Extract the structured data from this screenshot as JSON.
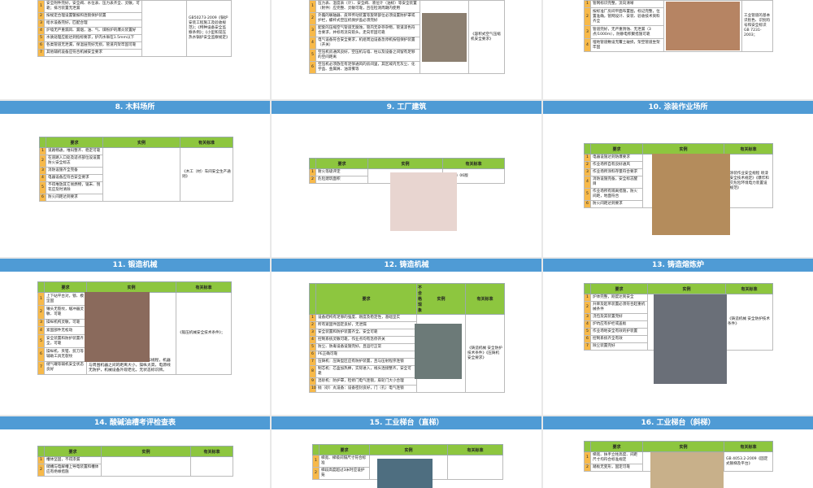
{
  "top_row": {
    "left": {
      "rows": [
        "安全附件完好，安全阀、水位表、压力表齐全、灵敏，可靠；排污装置无泄漏",
        "按规定合理设置警报和连锁保护装置",
        "给水设备完好，匹配合理",
        "炉墙无严重漏风、漏烟，油、气、煤粉炉的爆炎装置好",
        "水质处理应能达到指标要求，炉内水垢在1.5mm以下",
        "各类管道无泄漏，保温层完好无损，管道内架牢固可靠",
        "其他辅机设备应符合机械安全要求"
      ],
      "standard": "GB50273-2009《锅炉安装工程施工及验收规范》；《特种设备安全监察条例》；《小型和常压热水锅炉安全监察规定》"
    },
    "mid": {
      "rows": [
        "压力表、温度表（计）、安全阀、液位计（油标）等安全装置（附件）应完整、灵敏可靠，且在检测周期内使用",
        "外露的联轴器、皮带传动装置等旋转部位必须设置防护罩或护栏，螺杆式空压机保护盖必须完好",
        "配套的压缩空气管道无腐蚀，管内无杂存杂物，管道漆色符合要求，并标有流向箭头，走向牢固可靠",
        "电气设备符合安全要求，机组周边设备急停机按钮保护装置（开关）",
        "空压机房通风良好，空压机与墙、柱以及设备之间留有足够的空间距离",
        "空压机必须放在有足够通风的房间里，其区域内无灰尘、化学品、金属屑、油漆雾等"
      ],
      "standard": "《容积式空气压缩机安全要求》"
    },
    "right": {
      "rows": [
        "管网标识完整，流向清晰",
        "按标准厂房间平面布置图，标记完整，位置准确，管网设计、安装、验收技术资料齐全",
        "管道完好，无严重锈蚀、无泄漏（3点/1000m），防静电积聚措施可靠",
        "埋地管道敷设无覆土破损，架空管道坐架牢固"
      ],
      "standard": "工业管道的基本识别色、识别符号和安全标识 GB 7231-2003；"
    }
  },
  "slides": [
    {
      "title": "8. 木料场所",
      "headers": [
        "要求",
        "实例",
        "有关标准"
      ],
      "rows": [
        "道路畅通，堆码整齐、稳定可靠",
        "在道路入口处及适点部位设设置防火安全标志",
        "消防设施齐全完备",
        "电器设备应符合安全要求",
        "不得堆放其它易燃物，锯末、刨花应及时清除",
        "防火间距达到要求"
      ],
      "standard": "《木工（材）车间安全生产通则》"
    },
    {
      "title": "9. 工厂建筑",
      "headers": [
        "要求",
        "实例",
        "有关标准"
      ],
      "rows": [
        "耐火等级评定",
        "危险建筑面积"
      ],
      "standard": "《建规》06版"
    },
    {
      "title": "10. 涂装作业场所",
      "headers": [
        "要求",
        "实例",
        "有关标准"
      ],
      "rows": [
        "电器设施达到防爆要求",
        "作业场所自有良好通风",
        "作业场所涂料存量符合要求",
        "消防设施完备，安全标志醒目",
        "作业场所有隔离措施，防火间距，地面符合",
        "防火间距达到要求"
      ],
      "standard": "《涂装作业安全规程 喷漆室安全技术规定》《爆炸和火灾危险环境电力装置设计规范》"
    },
    {
      "title": "11. 锻造机械",
      "headers": [
        "要求",
        "实例",
        "有关标准"
      ],
      "rows": [
        "上下砧平台对，锁、模坚固",
        "锤头无裂纹，缓冲器灵敏、可靠",
        "操纵机构灵敏，可靠",
        "紧固部件无松动",
        "安全装置和防护装置齐全，可靠",
        "操纵机、夹钳、剪刀等辅助工具无裂纹",
        "储气罐等辅机安全状态良好"
      ],
      "example_note": "没有防护罩，没有安全标识，无操作规程，机器与周围机器之间的距离大小，操纵太高，电源线无防护，机械设备外观老化，无状态标识牌。",
      "standard": "《锻压机械安全技术条件》；"
    },
    {
      "title": "12. 铸造机械",
      "headers": [
        "要求",
        "不合格现象",
        "实例",
        "有关标准"
      ],
      "rows": [
        "设备结构有足够的强度、刚度及稳定性，基础坚实",
        "所有紧固件固定良好，无泄漏",
        "安全装置和防护装置齐全，安全可靠",
        "控制系统灵敏可靠，作业点均有急停开关",
        "防尘、防毒设备设施完好，且运行正常",
        "PE正确可靠",
        "压铸机：压铸型区应有防护装置，且与压射程序连锁",
        "制芯机：芯盒加热棒，实际进入，线头连接整齐，安全可靠",
        "混砂机：防护罩，检修门电气连锁，扇轮门大小合理",
        "抛（砂）丸设备：设备密封良好，门（孔）电气连锁"
      ],
      "standard": "《铸造机械 安全防护技术条件》《压铸机 安全要求》"
    },
    {
      "title": "13. 铸造熔炼炉",
      "headers": [
        "要求",
        "实例",
        "有关标准"
      ],
      "rows": [
        "炉体完整，刚度达到安全",
        "升降及起吊装置必须符合起重机械条件",
        "浇包及其装置完好",
        "炉坑应有护栏或盖板",
        "作业场地安全有效的护装置",
        "控制系统齐全有效",
        "除尘装置完好"
      ],
      "standard": "《铸造机械 安全防护技术条件》"
    },
    {
      "title": "14. 酸碱油槽考评检查表",
      "headers": [
        "要求",
        "实例",
        "有关标准"
      ],
      "rows": [
        "槽体坚固，不得渗漏",
        "储槽与电解槽上导电装置和槽体应有绝缘措施"
      ],
      "standard": ""
    },
    {
      "title": "15. 工业梯台（直梯）",
      "headers": [
        "要求",
        "实例",
        "有关标准"
      ],
      "rows": [
        "梯宽、梯级间隔尺寸符合标准",
        "梯段高度超过3米时应设护笼"
      ],
      "standard": ""
    },
    {
      "title": "16. 工业梯台（斜梯）",
      "headers": [
        "要求",
        "实例",
        "有关标准"
      ],
      "rows": [
        "梯宽、扶手立柱高度、间距尺寸均符合标准规定",
        "踏板无变形，固定可靠"
      ],
      "standard": "GB 4053.2-2009《固定式钢梯及平台》"
    }
  ]
}
